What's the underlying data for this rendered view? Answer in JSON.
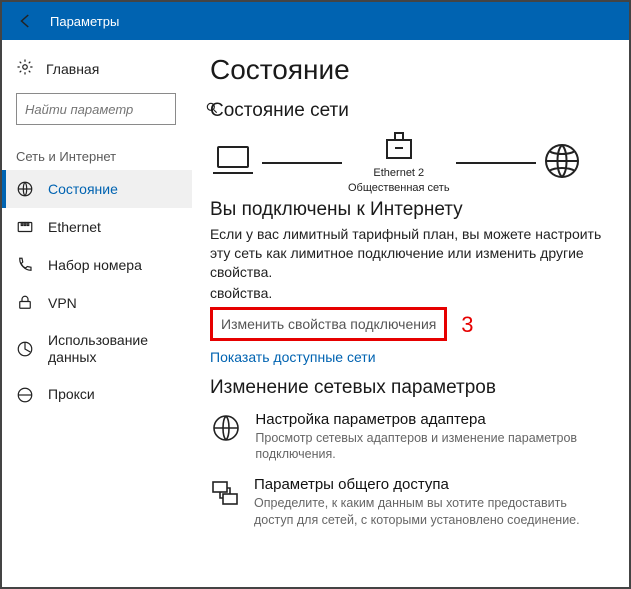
{
  "titlebar": {
    "title": "Параметры"
  },
  "sidebar": {
    "home": "Главная",
    "search_placeholder": "Найти параметр",
    "section": "Сеть и Интернет",
    "items": [
      {
        "label": "Состояние"
      },
      {
        "label": "Ethernet"
      },
      {
        "label": "Набор номера"
      },
      {
        "label": "VPN"
      },
      {
        "label": "Использование данных"
      },
      {
        "label": "Прокси"
      }
    ]
  },
  "content": {
    "page_title": "Состояние",
    "net_status_heading": "Состояние сети",
    "net_label_1": "Ethernet 2",
    "net_label_2": "Общественная сеть",
    "connected_heading": "Вы подключены к Интернету",
    "paragraph": "Если у вас лимитный тарифный план, вы можете настроить эту сеть как лимитное подключение или изменить другие свойства.",
    "paragraph_tail": "свойства.",
    "change_props": "Изменить свойства подключения",
    "callout_number": "3",
    "show_networks": "Показать доступные сети",
    "change_params_heading": "Изменение сетевых параметров",
    "options": [
      {
        "title": "Настройка параметров адаптера",
        "desc": "Просмотр сетевых адаптеров и изменение параметров подключения."
      },
      {
        "title": "Параметры общего доступа",
        "desc": "Определите, к каким данным вы хотите предоставить доступ для сетей, с которыми установлено соединение."
      }
    ]
  }
}
